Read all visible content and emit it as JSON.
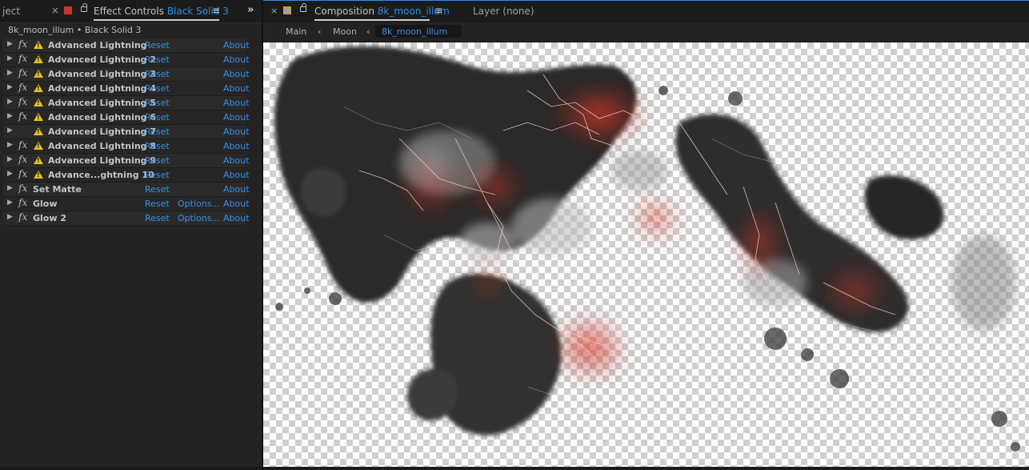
{
  "left_panel": {
    "project_tab_label": "ject",
    "effect_controls_tab": {
      "label": "Effect Controls",
      "layer": "Black Solid 3",
      "close": "×",
      "menu": "≡",
      "color": "#c8352f"
    },
    "expand": "»",
    "breadcrumb": "8k_moon_illum • Black Solid 3",
    "effects": [
      {
        "name": "Advanced Lightning",
        "warning": true,
        "fx": true,
        "reset": "Reset",
        "options": "",
        "about": "About"
      },
      {
        "name": "Advanced Lightning 2",
        "warning": true,
        "fx": true,
        "reset": "Reset",
        "options": "",
        "about": "About"
      },
      {
        "name": "Advanced Lightning 3",
        "warning": true,
        "fx": true,
        "reset": "Reset",
        "options": "",
        "about": "About"
      },
      {
        "name": "Advanced Lightning 4",
        "warning": true,
        "fx": true,
        "reset": "Reset",
        "options": "",
        "about": "About"
      },
      {
        "name": "Advanced Lightning 5",
        "warning": true,
        "fx": true,
        "reset": "Reset",
        "options": "",
        "about": "About"
      },
      {
        "name": "Advanced Lightning 6",
        "warning": true,
        "fx": true,
        "reset": "Reset",
        "options": "",
        "about": "About"
      },
      {
        "name": "Advanced Lightning 7",
        "warning": true,
        "fx": false,
        "reset": "Reset",
        "options": "",
        "about": "About"
      },
      {
        "name": "Advanced Lightning 8",
        "warning": true,
        "fx": true,
        "reset": "Reset",
        "options": "",
        "about": "About"
      },
      {
        "name": "Advanced Lightning 9",
        "warning": true,
        "fx": true,
        "reset": "Reset",
        "options": "",
        "about": "About"
      },
      {
        "name": "Advance...ghtning 10",
        "warning": true,
        "fx": true,
        "reset": "Reset",
        "options": "",
        "about": "About"
      },
      {
        "name": "Set Matte",
        "warning": false,
        "fx": true,
        "reset": "Reset",
        "options": "",
        "about": "About"
      },
      {
        "name": "Glow",
        "warning": false,
        "fx": true,
        "reset": "Reset",
        "options": "Options...",
        "about": "About"
      },
      {
        "name": "Glow 2",
        "warning": false,
        "fx": true,
        "reset": "Reset",
        "options": "Options...",
        "about": "About"
      }
    ],
    "fx_symbol": "fx",
    "expand_triangle": "▶"
  },
  "composition_panel": {
    "tab": {
      "close": "×",
      "label": "Composition",
      "name": "8k_moon_illum",
      "menu": "≡",
      "color": "#b79e7b"
    },
    "layer_tab": "Layer (none)",
    "breadcrumbs": {
      "main": "Main",
      "sep": "‹",
      "moon": "Moon",
      "current": "8k_moon_illum"
    }
  },
  "colors": {
    "accent_blue": "#2d8ceb",
    "link_blue": "#3a8fe6",
    "warning_yellow": "#e8c21c",
    "panel_bg": "#232323"
  }
}
